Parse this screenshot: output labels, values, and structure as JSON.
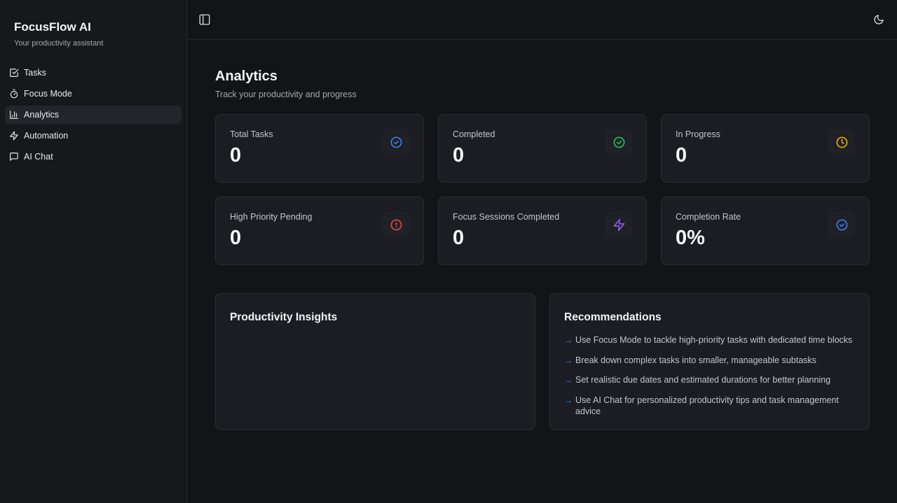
{
  "app": {
    "title": "FocusFlow AI",
    "subtitle": "Your productivity assistant"
  },
  "sidebar": {
    "items": [
      {
        "label": "Tasks",
        "icon": "checkbox-icon",
        "active": false
      },
      {
        "label": "Focus Mode",
        "icon": "timer-icon",
        "active": false
      },
      {
        "label": "Analytics",
        "icon": "bar-chart-icon",
        "active": true
      },
      {
        "label": "Automation",
        "icon": "lightning-icon",
        "active": false
      },
      {
        "label": "AI Chat",
        "icon": "chat-icon",
        "active": false
      }
    ]
  },
  "topbar": {
    "toggle_icon": "sidebar-toggle-icon",
    "theme_icon": "moon-icon"
  },
  "page": {
    "title": "Analytics",
    "subtitle": "Track your productivity and progress"
  },
  "stats": [
    {
      "label": "Total Tasks",
      "value": "0",
      "icon": "check-circle-icon",
      "color": "#3b82f6"
    },
    {
      "label": "Completed",
      "value": "0",
      "icon": "check-circle-icon",
      "color": "#22c55e"
    },
    {
      "label": "In Progress",
      "value": "0",
      "icon": "clock-icon",
      "color": "#eab308"
    },
    {
      "label": "High Priority Pending",
      "value": "0",
      "icon": "alert-circle-icon",
      "color": "#ef4444"
    },
    {
      "label": "Focus Sessions Completed",
      "value": "0",
      "icon": "lightning-icon",
      "color": "#8b5cf6"
    },
    {
      "label": "Completion Rate",
      "value": "0%",
      "icon": "check-circle-icon",
      "color": "#3b82f6"
    }
  ],
  "insights": {
    "title": "Productivity Insights"
  },
  "recommendations": {
    "title": "Recommendations",
    "arrow": "→",
    "items": [
      "Use Focus Mode to tackle high-priority tasks with dedicated time blocks",
      "Break down complex tasks into smaller, manageable subtasks",
      "Set realistic due dates and estimated durations for better planning",
      "Use AI Chat for personalized productivity tips and task management advice"
    ]
  },
  "colors": {
    "background": "#131417",
    "sidebar": "#17181c",
    "card": "#1b1d22",
    "accent": "#3b82f6"
  }
}
